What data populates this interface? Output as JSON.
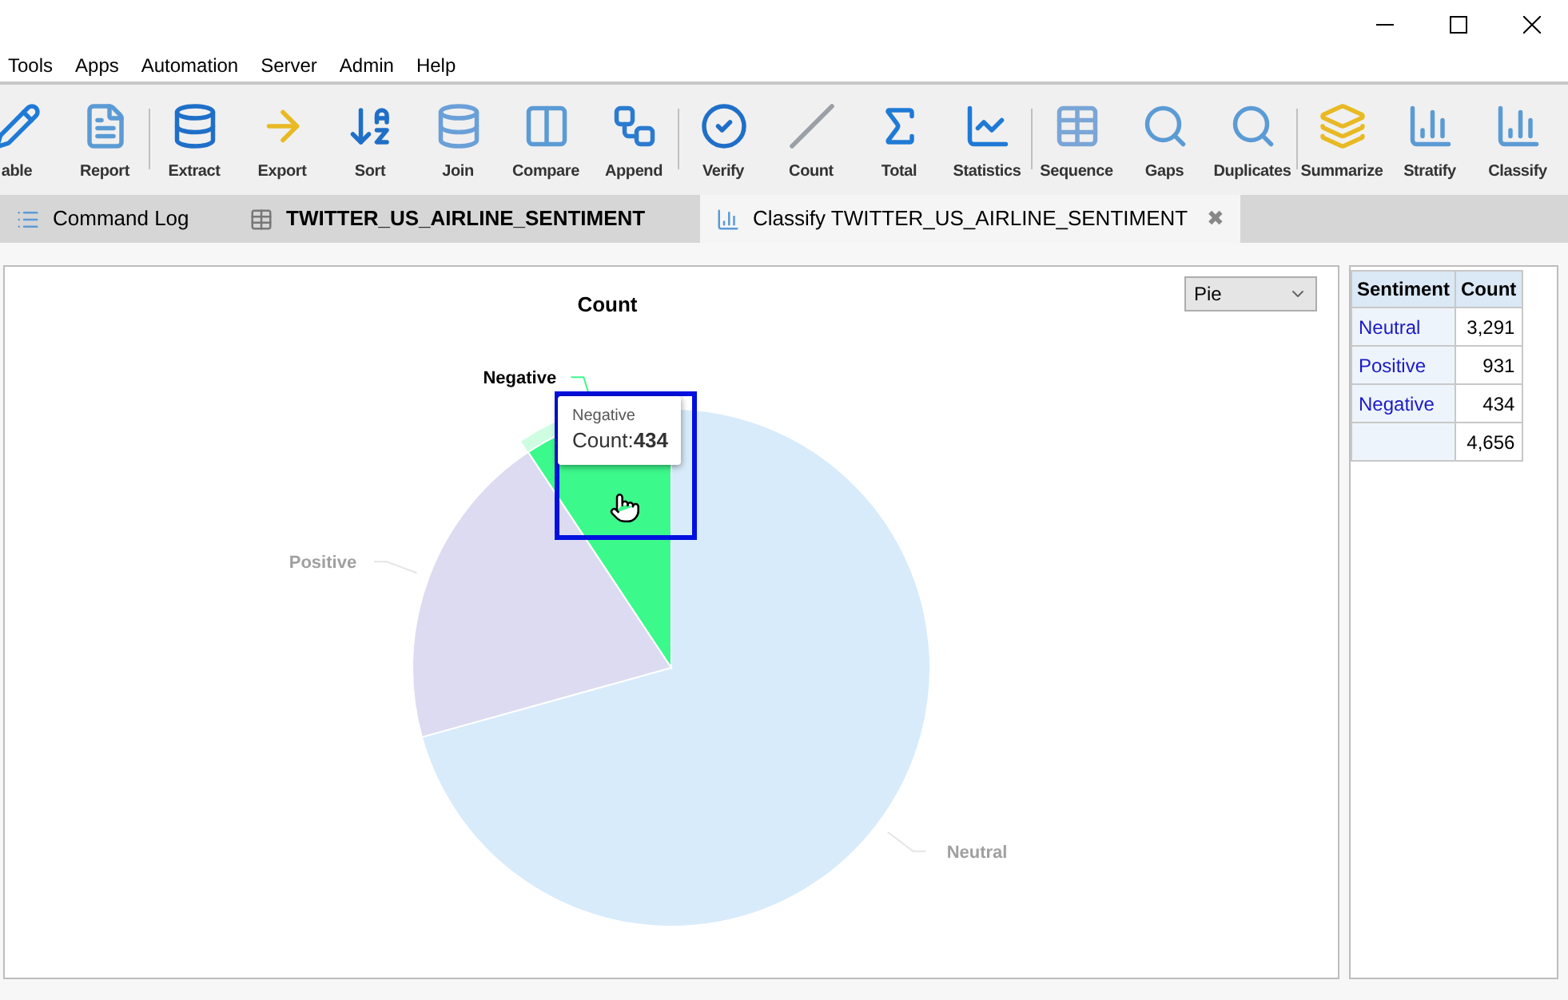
{
  "menu": [
    "Tools",
    "Apps",
    "Automation",
    "Server",
    "Admin",
    "Help"
  ],
  "toolbar": [
    {
      "label": "able"
    },
    {
      "label": "Report"
    },
    {
      "label": "Extract"
    },
    {
      "label": "Export"
    },
    {
      "label": "Sort"
    },
    {
      "label": "Join"
    },
    {
      "label": "Compare"
    },
    {
      "label": "Append"
    },
    {
      "label": "Verify"
    },
    {
      "label": "Count"
    },
    {
      "label": "Total"
    },
    {
      "label": "Statistics"
    },
    {
      "label": "Sequence"
    },
    {
      "label": "Gaps"
    },
    {
      "label": "Duplicates"
    },
    {
      "label": "Summarize"
    },
    {
      "label": "Stratify"
    },
    {
      "label": "Classify"
    }
  ],
  "tabs": [
    {
      "label": "Command Log",
      "selected": false,
      "bold": false
    },
    {
      "label": "TWITTER_US_AIRLINE_SENTIMENT",
      "selected": false,
      "bold": true
    },
    {
      "label": "Classify TWITTER_US_AIRLINE_SENTIMENT",
      "selected": true,
      "bold": false,
      "close": "✖"
    }
  ],
  "chart_type_select": {
    "value": "Pie"
  },
  "chart": {
    "chart_data": {
      "type": "pie",
      "title": "Count",
      "categories": [
        "Neutral",
        "Positive",
        "Negative"
      ],
      "series": [
        {
          "values": [
            70.68,
            20.0,
            9.32
          ]
        }
      ]
    },
    "slices": [
      {
        "color": "#d7ebfb",
        "highlighted": false
      },
      {
        "color": "#dddbf1",
        "highlighted": false
      },
      {
        "color": "#3cf98c",
        "highlighted": true
      }
    ],
    "tooltip": {
      "title": "Negative",
      "text": "Count:**434**"
    }
  },
  "table": {
    "columns": [
      "Sentiment",
      "Count"
    ],
    "rows": [
      [
        "Neutral",
        "3,291"
      ],
      [
        "Positive",
        "931"
      ],
      [
        "Negative",
        "434"
      ],
      [
        "",
        "4,656"
      ]
    ]
  }
}
